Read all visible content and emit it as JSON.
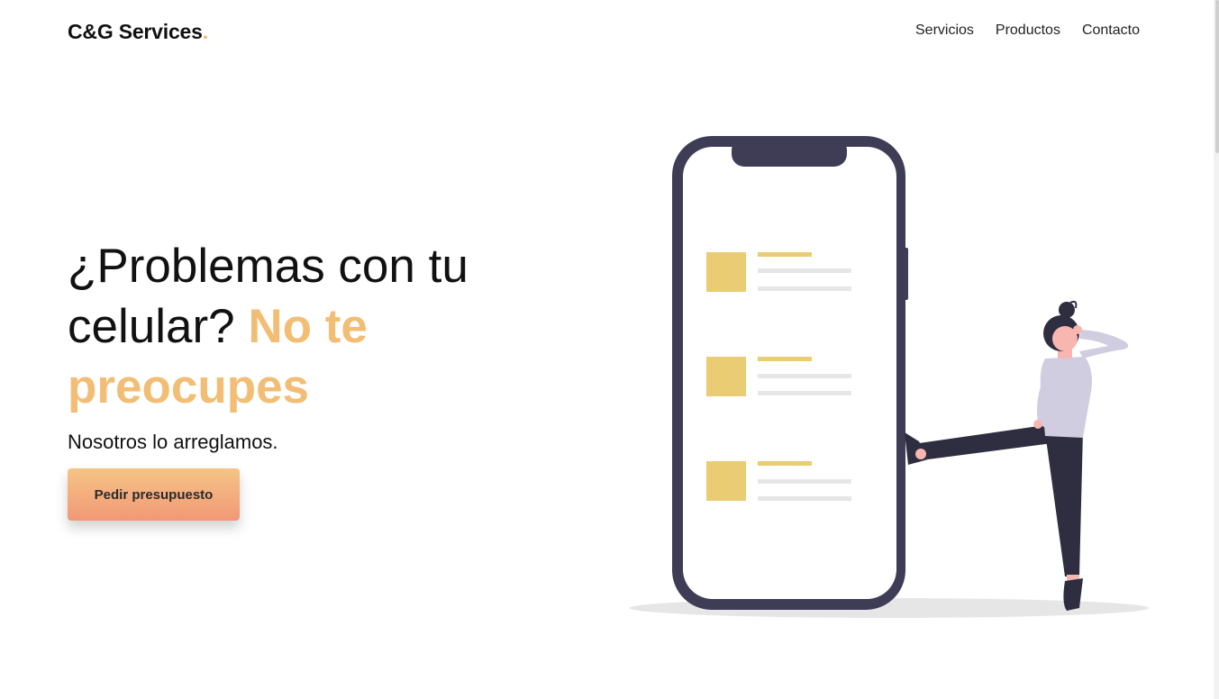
{
  "header": {
    "logo_text": "C&G Services",
    "logo_dot": ".",
    "nav": {
      "servicios": "Servicios",
      "productos": "Productos",
      "contacto": "Contacto"
    }
  },
  "hero": {
    "title_plain": "¿Problemas con tu celular?",
    "title_accent": "No te preocupes",
    "subtitle": "Nosotros lo arreglamos.",
    "cta_label": "Pedir presupuesto"
  },
  "colors": {
    "accent": "#f2bd74",
    "button_gradient_top": "#f5c485",
    "button_gradient_bottom": "#f29877",
    "phone_frame": "#3f3d56",
    "list_square": "#e9cc74"
  },
  "icons": {
    "illustration": "phone-and-woman-illustration"
  }
}
